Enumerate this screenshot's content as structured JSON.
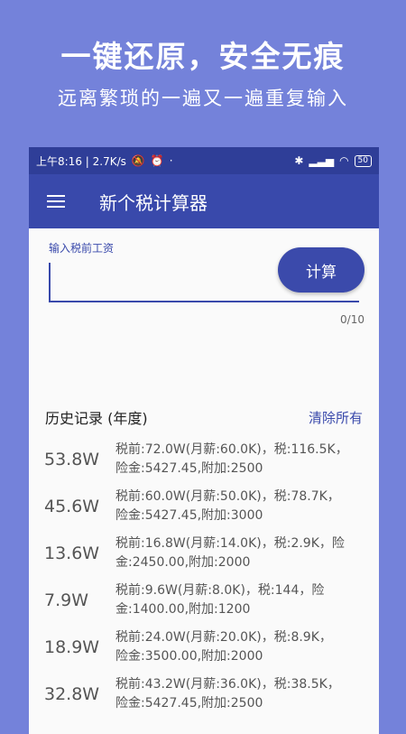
{
  "promo": {
    "title": "一键还原，安全无痕",
    "subtitle": "远离繁琐的一遍又一遍重复输入"
  },
  "status_bar": {
    "time_speed": "上午8:16 | 2.7K/s",
    "battery": "50"
  },
  "app_bar": {
    "title": "新个税计算器"
  },
  "form": {
    "label": "输入税前工资",
    "value": "",
    "counter": "0/10",
    "calc_button": "计算"
  },
  "history": {
    "title": "历史记录 (年度)",
    "clear_all": "清除所有",
    "items": [
      {
        "total": "53.8W",
        "line1": "税前:72.0W(月薪:60.0K)，税:116.5K，",
        "line2": "险金:5427.45,附加:2500"
      },
      {
        "total": "45.6W",
        "line1": "税前:60.0W(月薪:50.0K)，税:78.7K，",
        "line2": "险金:5427.45,附加:3000"
      },
      {
        "total": "13.6W",
        "line1": "税前:16.8W(月薪:14.0K)，税:2.9K，险",
        "line2": "金:2450.00,附加:2000"
      },
      {
        "total": "7.9W",
        "line1": "税前:9.6W(月薪:8.0K)，税:144，险",
        "line2": "金:1400.00,附加:1200"
      },
      {
        "total": "18.9W",
        "line1": "税前:24.0W(月薪:20.0K)，税:8.9K，",
        "line2": "险金:3500.00,附加:2000"
      },
      {
        "total": "32.8W",
        "line1": "税前:43.2W(月薪:36.0K)，税:38.5K，",
        "line2": "险金:5427.45,附加:2500"
      }
    ]
  }
}
